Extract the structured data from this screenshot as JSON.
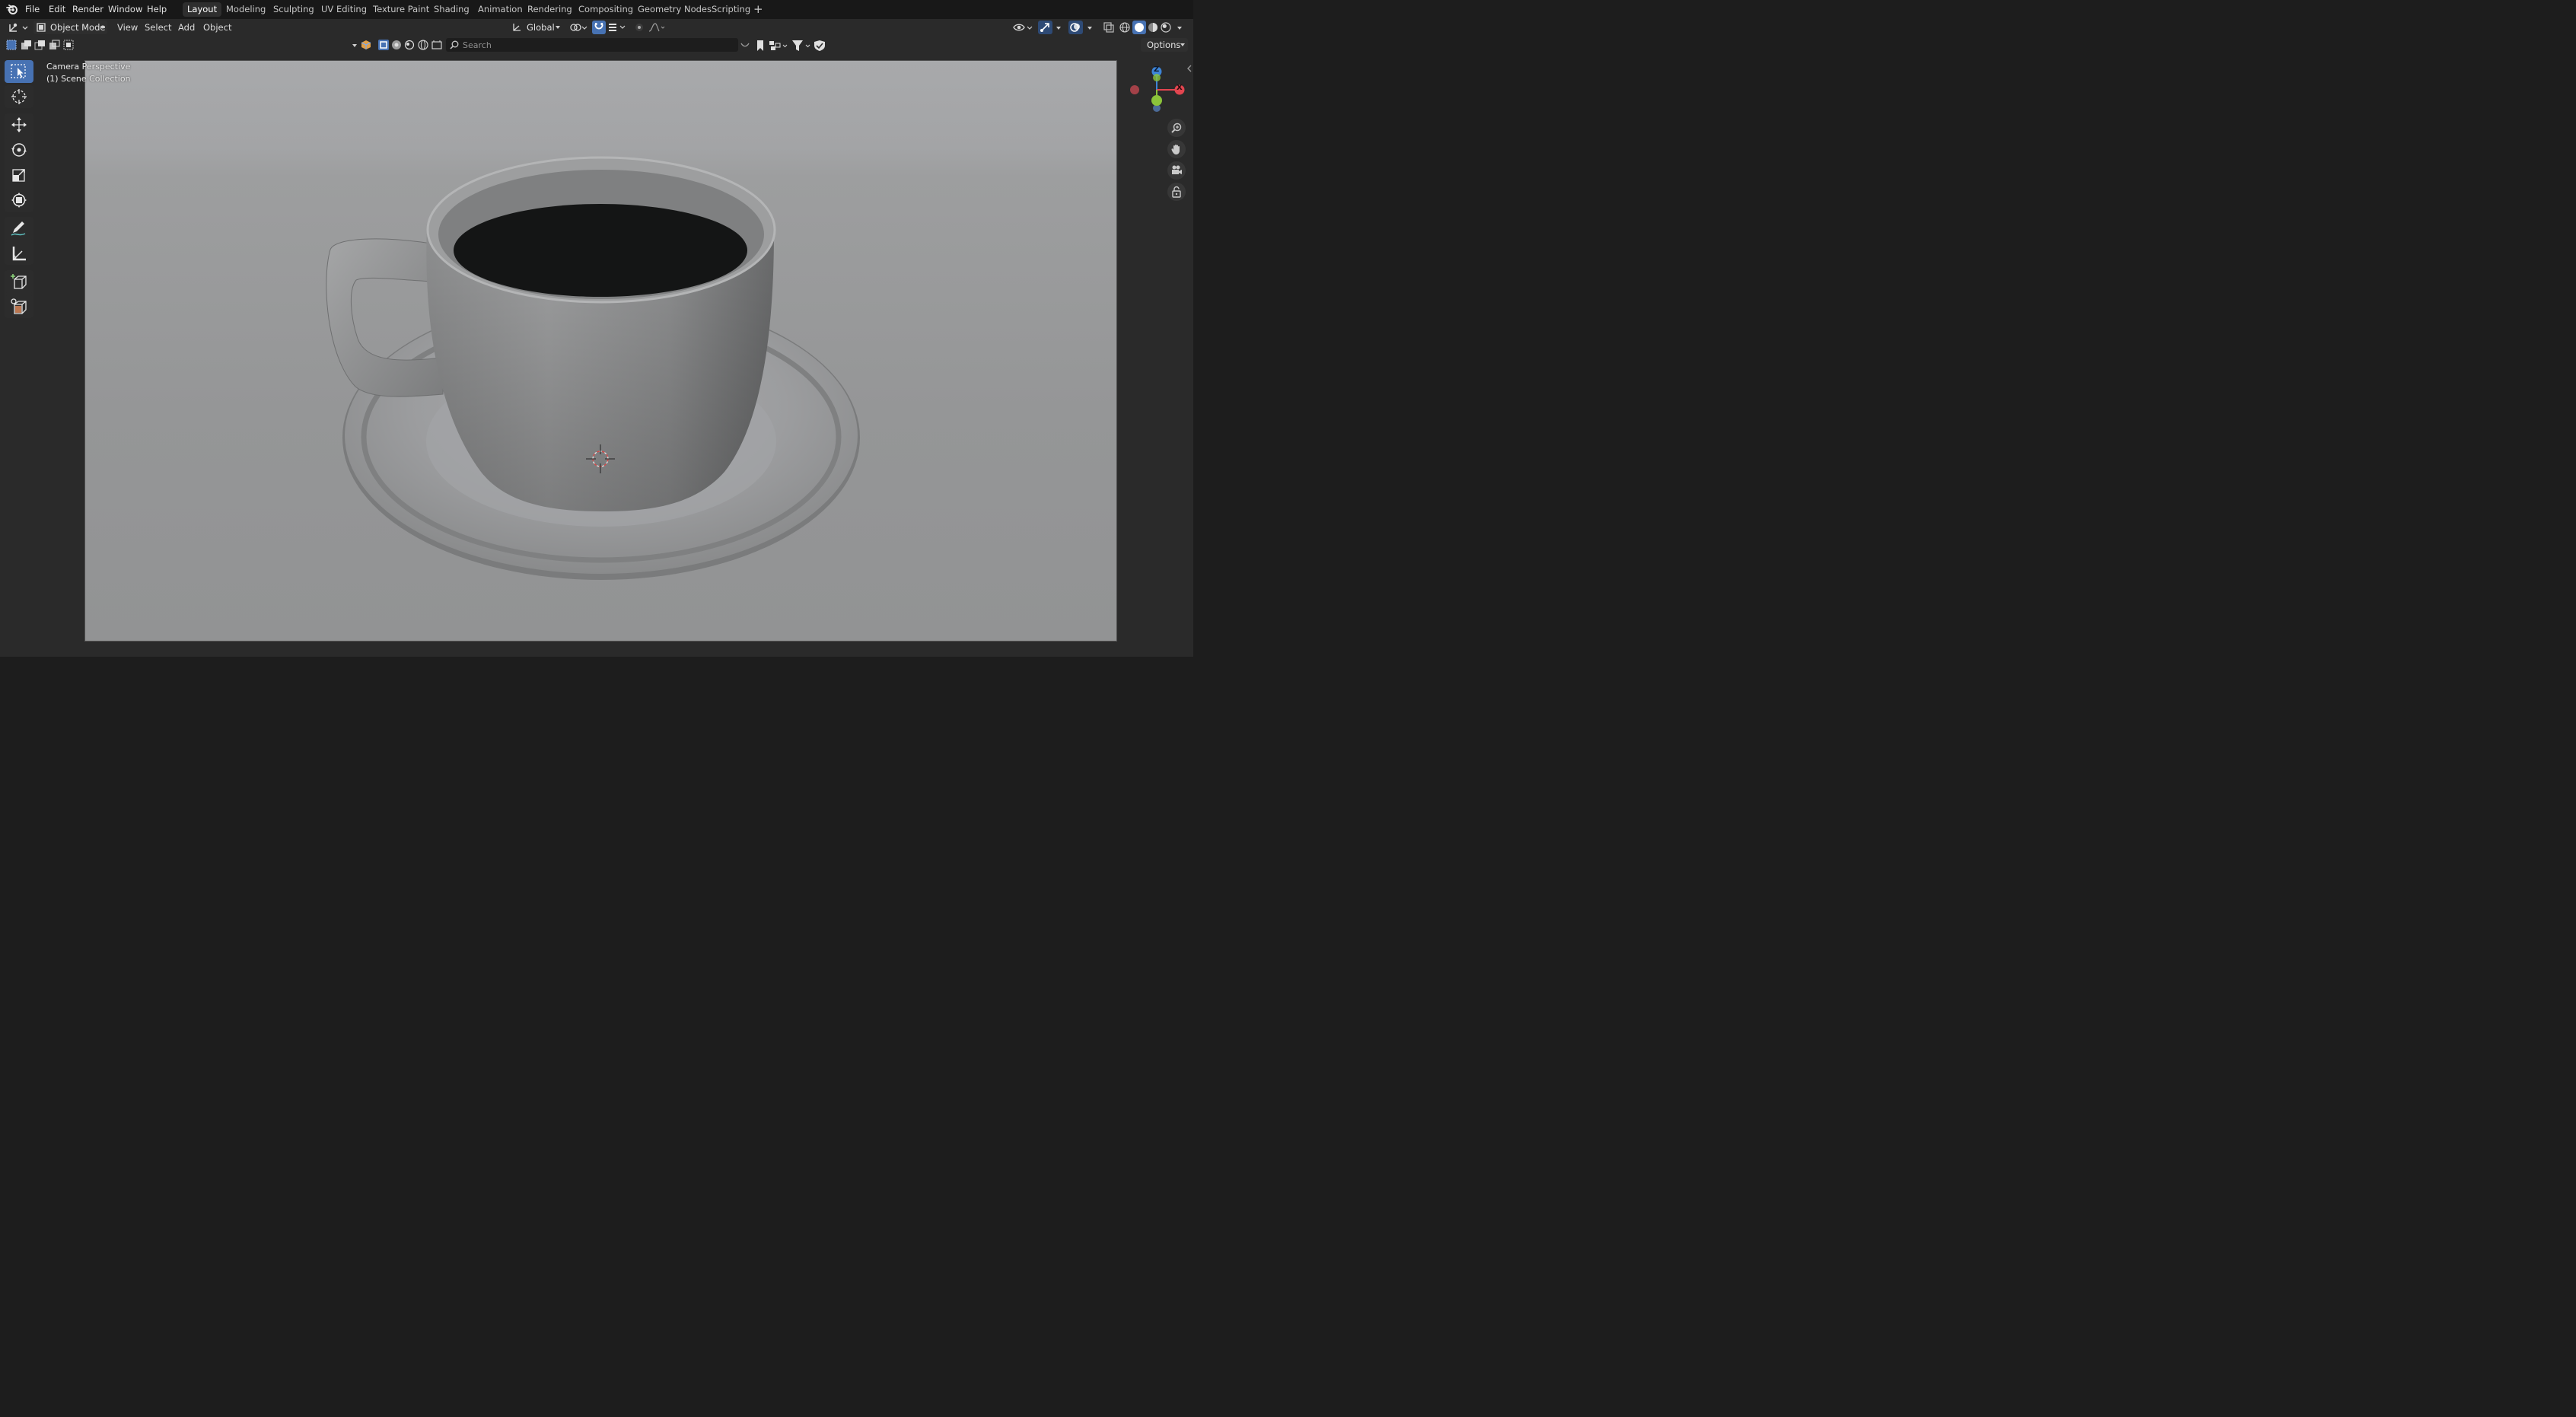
{
  "topbar": {
    "menus": [
      "File",
      "Edit",
      "Render",
      "Window",
      "Help"
    ],
    "workspaces": [
      "Layout",
      "Modeling",
      "Sculpting",
      "UV Editing",
      "Texture Paint",
      "Shading",
      "Animation",
      "Rendering",
      "Compositing",
      "Geometry Nodes",
      "Scripting"
    ],
    "active_workspace": "Layout",
    "add_tab_label": "+"
  },
  "header": {
    "mode_label": "Object Mode",
    "menus": [
      "View",
      "Select",
      "Add",
      "Object"
    ],
    "orientation_label": "Global"
  },
  "toolbar2": {
    "search_placeholder": "Search",
    "options_label": "Options"
  },
  "viewport": {
    "perspective_label": "Camera Perspective",
    "collection_label": "(1) Scene Collection"
  },
  "gizmo": {
    "z_label": "Z",
    "x_label": "X",
    "colors": {
      "x": "#e2454f",
      "y": "#8bc33a",
      "z": "#3d84d6"
    }
  },
  "colors": {
    "accent": "#4772b3",
    "active_tab": "#2e2e2e"
  }
}
